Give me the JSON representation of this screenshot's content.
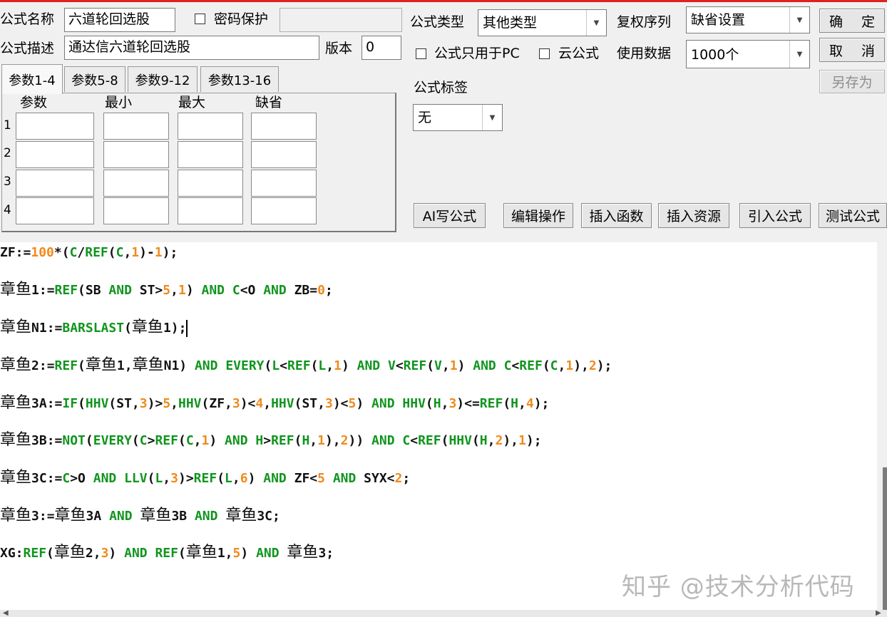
{
  "form": {
    "name_label": "公式名称",
    "name_value": "六道轮回选股",
    "password_label": "密码保护",
    "password_value": "",
    "desc_label": "公式描述",
    "desc_value": "通达信六道轮回选股",
    "version_label": "版本",
    "version_value": "0",
    "type_label": "公式类型",
    "type_value": "其他类型",
    "pc_only_label": "公式只用于PC",
    "cloud_label": "云公式",
    "adjust_label": "复权序列",
    "adjust_value": "缺省设置",
    "data_label": "使用数据",
    "data_value": "1000个",
    "tag_label": "公式标签",
    "tag_value": "无"
  },
  "buttons": {
    "ok": "确 定",
    "cancel": "取 消",
    "save_as": "另存为",
    "ai_write": "AI写公式",
    "edit_ops": "编辑操作",
    "insert_func": "插入函数",
    "insert_res": "插入资源",
    "import_formula": "引入公式",
    "test_formula": "测试公式"
  },
  "tabs": [
    "参数1-4",
    "参数5-8",
    "参数9-12",
    "参数13-16"
  ],
  "params": {
    "headers": [
      "参数",
      "最小",
      "最大",
      "缺省"
    ],
    "rows": [
      "1",
      "2",
      "3",
      "4"
    ]
  },
  "code": [
    [
      [
        "p",
        "ZF:="
      ],
      [
        "n",
        "100"
      ],
      [
        "p",
        "*("
      ],
      [
        "k",
        "C"
      ],
      [
        "p",
        "/"
      ],
      [
        "k",
        "REF"
      ],
      [
        "p",
        "("
      ],
      [
        "k",
        "C"
      ],
      [
        "p",
        ","
      ],
      [
        "n",
        "1"
      ],
      [
        "p",
        ")-"
      ],
      [
        "n",
        "1"
      ],
      [
        "p",
        ");"
      ]
    ],
    [
      [
        "h",
        "章鱼"
      ],
      [
        "p",
        "1:="
      ],
      [
        "k",
        "REF"
      ],
      [
        "p",
        "(SB "
      ],
      [
        "k",
        "AND"
      ],
      [
        "p",
        " ST>"
      ],
      [
        "n",
        "5"
      ],
      [
        "p",
        ","
      ],
      [
        "n",
        "1"
      ],
      [
        "p",
        ") "
      ],
      [
        "k",
        "AND"
      ],
      [
        "p",
        " "
      ],
      [
        "k",
        "C"
      ],
      [
        "p",
        "<O "
      ],
      [
        "k",
        "AND"
      ],
      [
        "p",
        " ZB="
      ],
      [
        "n",
        "0"
      ],
      [
        "p",
        ";"
      ]
    ],
    [
      [
        "h",
        "章鱼"
      ],
      [
        "p",
        "N1:="
      ],
      [
        "k",
        "BARSLAST"
      ],
      [
        "p",
        "("
      ],
      [
        "h",
        "章鱼"
      ],
      [
        "p",
        "1);"
      ]
    ],
    [
      [
        "h",
        "章鱼"
      ],
      [
        "p",
        "2:="
      ],
      [
        "k",
        "REF"
      ],
      [
        "p",
        "("
      ],
      [
        "h",
        "章鱼"
      ],
      [
        "p",
        "1,"
      ],
      [
        "h",
        "章鱼"
      ],
      [
        "p",
        "N1) "
      ],
      [
        "k",
        "AND"
      ],
      [
        "p",
        " "
      ],
      [
        "k",
        "EVERY"
      ],
      [
        "p",
        "("
      ],
      [
        "k",
        "L"
      ],
      [
        "p",
        "<"
      ],
      [
        "k",
        "REF"
      ],
      [
        "p",
        "("
      ],
      [
        "k",
        "L"
      ],
      [
        "p",
        ","
      ],
      [
        "n",
        "1"
      ],
      [
        "p",
        ") "
      ],
      [
        "k",
        "AND"
      ],
      [
        "p",
        " "
      ],
      [
        "k",
        "V"
      ],
      [
        "p",
        "<"
      ],
      [
        "k",
        "REF"
      ],
      [
        "p",
        "("
      ],
      [
        "k",
        "V"
      ],
      [
        "p",
        ","
      ],
      [
        "n",
        "1"
      ],
      [
        "p",
        ") "
      ],
      [
        "k",
        "AND"
      ],
      [
        "p",
        " "
      ],
      [
        "k",
        "C"
      ],
      [
        "p",
        "<"
      ],
      [
        "k",
        "REF"
      ],
      [
        "p",
        "("
      ],
      [
        "k",
        "C"
      ],
      [
        "p",
        ","
      ],
      [
        "n",
        "1"
      ],
      [
        "p",
        "),"
      ],
      [
        "n",
        "2"
      ],
      [
        "p",
        ");"
      ]
    ],
    [
      [
        "h",
        "章鱼"
      ],
      [
        "p",
        "3A:="
      ],
      [
        "k",
        "IF"
      ],
      [
        "p",
        "("
      ],
      [
        "k",
        "HHV"
      ],
      [
        "p",
        "(ST,"
      ],
      [
        "n",
        "3"
      ],
      [
        "p",
        ")>"
      ],
      [
        "n",
        "5"
      ],
      [
        "p",
        ","
      ],
      [
        "k",
        "HHV"
      ],
      [
        "p",
        "(ZF,"
      ],
      [
        "n",
        "3"
      ],
      [
        "p",
        ")<"
      ],
      [
        "n",
        "4"
      ],
      [
        "p",
        ","
      ],
      [
        "k",
        "HHV"
      ],
      [
        "p",
        "(ST,"
      ],
      [
        "n",
        "3"
      ],
      [
        "p",
        ")<"
      ],
      [
        "n",
        "5"
      ],
      [
        "p",
        ") "
      ],
      [
        "k",
        "AND"
      ],
      [
        "p",
        " "
      ],
      [
        "k",
        "HHV"
      ],
      [
        "p",
        "("
      ],
      [
        "k",
        "H"
      ],
      [
        "p",
        ","
      ],
      [
        "n",
        "3"
      ],
      [
        "p",
        ")<="
      ],
      [
        "k",
        "REF"
      ],
      [
        "p",
        "("
      ],
      [
        "k",
        "H"
      ],
      [
        "p",
        ","
      ],
      [
        "n",
        "4"
      ],
      [
        "p",
        ");"
      ]
    ],
    [
      [
        "h",
        "章鱼"
      ],
      [
        "p",
        "3B:="
      ],
      [
        "k",
        "NOT"
      ],
      [
        "p",
        "("
      ],
      [
        "k",
        "EVERY"
      ],
      [
        "p",
        "("
      ],
      [
        "k",
        "C"
      ],
      [
        "p",
        ">"
      ],
      [
        "k",
        "REF"
      ],
      [
        "p",
        "("
      ],
      [
        "k",
        "C"
      ],
      [
        "p",
        ","
      ],
      [
        "n",
        "1"
      ],
      [
        "p",
        ") "
      ],
      [
        "k",
        "AND"
      ],
      [
        "p",
        " "
      ],
      [
        "k",
        "H"
      ],
      [
        "p",
        ">"
      ],
      [
        "k",
        "REF"
      ],
      [
        "p",
        "("
      ],
      [
        "k",
        "H"
      ],
      [
        "p",
        ","
      ],
      [
        "n",
        "1"
      ],
      [
        "p",
        "),"
      ],
      [
        "n",
        "2"
      ],
      [
        "p",
        "))"
      ],
      [
        "p",
        " "
      ],
      [
        "k",
        "AND"
      ],
      [
        "p",
        " "
      ],
      [
        "k",
        "C"
      ],
      [
        "p",
        "<"
      ],
      [
        "k",
        "REF"
      ],
      [
        "p",
        "("
      ],
      [
        "k",
        "HHV"
      ],
      [
        "p",
        "("
      ],
      [
        "k",
        "H"
      ],
      [
        "p",
        ","
      ],
      [
        "n",
        "2"
      ],
      [
        "p",
        "),"
      ],
      [
        "n",
        "1"
      ],
      [
        "p",
        ");"
      ]
    ],
    [
      [
        "h",
        "章鱼"
      ],
      [
        "p",
        "3C:="
      ],
      [
        "k",
        "C"
      ],
      [
        "p",
        ">O "
      ],
      [
        "k",
        "AND"
      ],
      [
        "p",
        " "
      ],
      [
        "k",
        "LLV"
      ],
      [
        "p",
        "("
      ],
      [
        "k",
        "L"
      ],
      [
        "p",
        ","
      ],
      [
        "n",
        "3"
      ],
      [
        "p",
        ")>"
      ],
      [
        "k",
        "REF"
      ],
      [
        "p",
        "("
      ],
      [
        "k",
        "L"
      ],
      [
        "p",
        ","
      ],
      [
        "n",
        "6"
      ],
      [
        "p",
        ") "
      ],
      [
        "k",
        "AND"
      ],
      [
        "p",
        " ZF<"
      ],
      [
        "n",
        "5"
      ],
      [
        "p",
        " "
      ],
      [
        "k",
        "AND"
      ],
      [
        "p",
        " SYX<"
      ],
      [
        "n",
        "2"
      ],
      [
        "p",
        ";"
      ]
    ],
    [
      [
        "h",
        "章鱼"
      ],
      [
        "p",
        "3:="
      ],
      [
        "h",
        "章鱼"
      ],
      [
        "p",
        "3A "
      ],
      [
        "k",
        "AND"
      ],
      [
        "p",
        " "
      ],
      [
        "h",
        "章鱼"
      ],
      [
        "p",
        "3B "
      ],
      [
        "k",
        "AND"
      ],
      [
        "p",
        " "
      ],
      [
        "h",
        "章鱼"
      ],
      [
        "p",
        "3C;"
      ]
    ],
    [
      [
        "p",
        "XG:"
      ],
      [
        "k",
        "REF"
      ],
      [
        "p",
        "("
      ],
      [
        "h",
        "章鱼"
      ],
      [
        "p",
        "2,"
      ],
      [
        "n",
        "3"
      ],
      [
        "p",
        ") "
      ],
      [
        "k",
        "AND"
      ],
      [
        "p",
        " "
      ],
      [
        "k",
        "REF"
      ],
      [
        "p",
        "("
      ],
      [
        "h",
        "章鱼"
      ],
      [
        "p",
        "1,"
      ],
      [
        "n",
        "5"
      ],
      [
        "p",
        ") "
      ],
      [
        "k",
        "AND"
      ],
      [
        "p",
        " "
      ],
      [
        "h",
        "章鱼"
      ],
      [
        "p",
        "3;"
      ]
    ]
  ],
  "watermark": "知乎 @技术分析代码"
}
